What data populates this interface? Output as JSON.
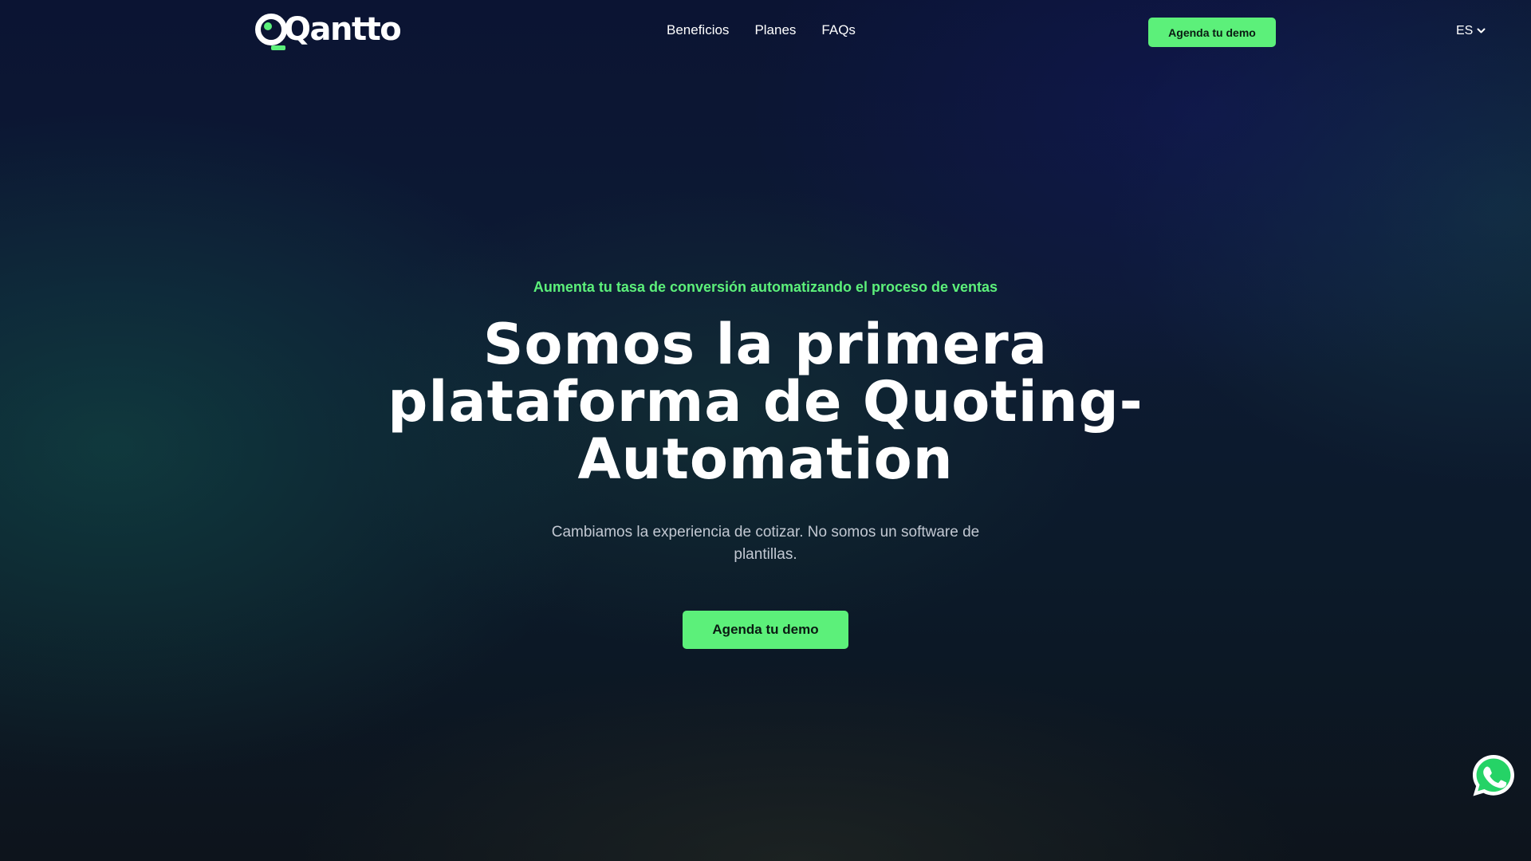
{
  "brand": {
    "name": "Qantto"
  },
  "nav": {
    "items": [
      {
        "label": "Beneficios"
      },
      {
        "label": "Planes"
      },
      {
        "label": "FAQs"
      }
    ]
  },
  "header": {
    "cta_label": "Agenda tu demo",
    "language": "ES"
  },
  "hero": {
    "eyebrow": "Aumenta tu tasa de conversión automatizando el proceso de ventas",
    "headline": "Somos la primera plataforma de Quoting-Automation",
    "subtitle": "Cambiamos la experiencia de cotizar. No somos un software de plantillas.",
    "cta_label": "Agenda tu demo"
  },
  "floating": {
    "icon": "whatsapp-icon"
  },
  "colors": {
    "accent": "#5cf07a",
    "background": "#0c1a2e",
    "whatsapp": "#25d366"
  }
}
